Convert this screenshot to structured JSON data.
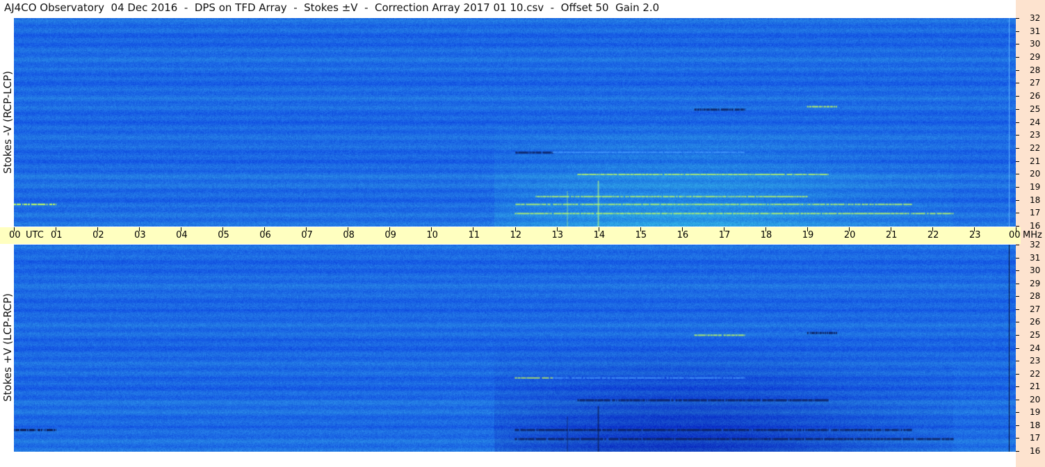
{
  "title": "AJ4CO Observatory  04 Dec 2016  -  DPS on TFD Array  -  Stokes ±V  -  Correction Array 2017 01 10.csv  -  Offset 50  Gain 2.0",
  "colors": {
    "background": "#ffffff",
    "freq_strip": "#fde3cf",
    "time_strip": "#ffffc0",
    "spectrogram_base": "#1f6fe6"
  },
  "chart_data": [
    {
      "type": "heatmap",
      "ylabel": "Stokes -V (RCP-LCP)",
      "x_axis": {
        "range": [
          0,
          24
        ],
        "tick_labels": [
          "00",
          "01",
          "02",
          "03",
          "04",
          "05",
          "06",
          "07",
          "08",
          "09",
          "10",
          "11",
          "12",
          "13",
          "14",
          "15",
          "16",
          "17",
          "18",
          "19",
          "20",
          "21",
          "22",
          "23",
          "00"
        ],
        "unit_label": "UTC"
      },
      "y_axis": {
        "range": [
          16,
          32
        ],
        "tick_labels": [
          "32",
          "31",
          "30",
          "29",
          "28",
          "27",
          "26",
          "25",
          "24",
          "23",
          "22",
          "21",
          "20",
          "19",
          "18",
          "17",
          "16"
        ]
      },
      "polarity": "positive",
      "features": [
        {
          "utc": [
            12.0,
            22.5
          ],
          "mhz": 17.0,
          "kind": "bright"
        },
        {
          "utc": [
            12.0,
            21.5
          ],
          "mhz": 17.7,
          "kind": "bright"
        },
        {
          "utc": [
            12.5,
            19.0
          ],
          "mhz": 18.3,
          "kind": "bright"
        },
        {
          "utc": [
            13.5,
            19.5
          ],
          "mhz": 20.0,
          "kind": "bright"
        },
        {
          "utc": [
            12.0,
            12.9
          ],
          "mhz": 21.7,
          "kind": "dark"
        },
        {
          "utc": [
            12.9,
            17.5
          ],
          "mhz": 21.7,
          "kind": "faint"
        },
        {
          "utc": [
            16.3,
            17.5
          ],
          "mhz": 25.0,
          "kind": "dark"
        },
        {
          "utc": [
            19.0,
            19.7
          ],
          "mhz": 25.2,
          "kind": "bright"
        },
        {
          "utc": [
            0.0,
            1.0
          ],
          "mhz": 17.7,
          "kind": "bright"
        }
      ]
    },
    {
      "type": "heatmap",
      "ylabel": "Stokes +V (LCP-RCP)",
      "x_axis": {
        "range": [
          0,
          24
        ],
        "tick_labels": [
          "00",
          "01",
          "02",
          "03",
          "04",
          "05",
          "06",
          "07",
          "08",
          "09",
          "10",
          "11",
          "12",
          "13",
          "14",
          "15",
          "16",
          "17",
          "18",
          "19",
          "20",
          "21",
          "22",
          "23",
          "00"
        ],
        "unit_label": "UTC"
      },
      "y_axis": {
        "range": [
          16,
          32
        ],
        "tick_labels": [
          "32",
          "31",
          "30",
          "29",
          "28",
          "27",
          "26",
          "25",
          "24",
          "23",
          "22",
          "21",
          "20",
          "19",
          "18",
          "17",
          "16"
        ]
      },
      "polarity": "negative",
      "features": [
        {
          "utc": [
            12.0,
            22.5
          ],
          "mhz": 17.0,
          "kind": "dark"
        },
        {
          "utc": [
            12.0,
            21.5
          ],
          "mhz": 17.7,
          "kind": "dark"
        },
        {
          "utc": [
            13.5,
            19.5
          ],
          "mhz": 20.0,
          "kind": "dark"
        },
        {
          "utc": [
            12.0,
            12.9
          ],
          "mhz": 21.7,
          "kind": "bright"
        },
        {
          "utc": [
            12.9,
            17.5
          ],
          "mhz": 21.7,
          "kind": "faint"
        },
        {
          "utc": [
            16.3,
            17.5
          ],
          "mhz": 25.0,
          "kind": "bright"
        },
        {
          "utc": [
            19.0,
            19.7
          ],
          "mhz": 25.2,
          "kind": "dark"
        },
        {
          "utc": [
            0.0,
            1.0
          ],
          "mhz": 17.7,
          "kind": "dark"
        }
      ]
    }
  ],
  "mhz_unit": "MHz",
  "utc_unit": "UTC"
}
